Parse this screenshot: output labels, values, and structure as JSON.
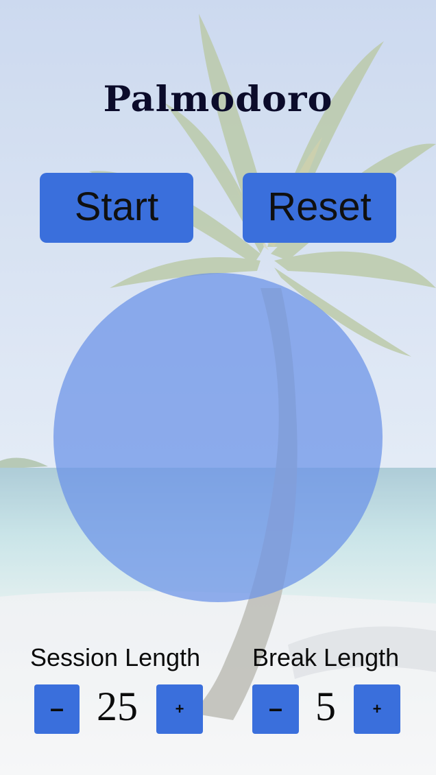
{
  "app": {
    "title": "Palmodoro"
  },
  "controls": {
    "start_label": "Start",
    "reset_label": "Reset"
  },
  "timer": {
    "display": ""
  },
  "session": {
    "label": "Session Length",
    "value": "25",
    "decrement_label": "–",
    "increment_label": "+"
  },
  "break": {
    "label": "Break Length",
    "value": "5",
    "decrement_label": "–",
    "increment_label": "+"
  },
  "colors": {
    "button": "#3a6fdc",
    "timer_circle": "#6a92e8",
    "sky": "#c7d6ee",
    "sea": "#9fcbd6",
    "sand": "#eef1f3"
  },
  "background": {
    "scene": "beach-palm-tree"
  }
}
